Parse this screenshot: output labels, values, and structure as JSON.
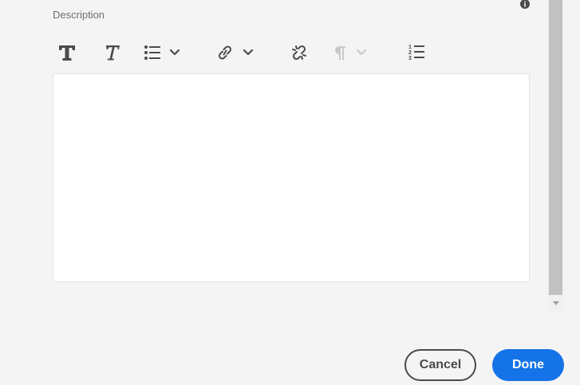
{
  "field": {
    "label": "Description"
  },
  "toolbar": {
    "icons": [
      "bold-text-icon",
      "italic-text-icon",
      "bullet-list-icon",
      "chevron-down-icon",
      "link-icon",
      "chevron-down-icon",
      "unlink-icon",
      "paragraph-icon",
      "chevron-down-icon",
      "numbered-list-icon"
    ],
    "paragraph_disabled": true
  },
  "editor": {
    "value": ""
  },
  "footer": {
    "cancel_label": "Cancel",
    "done_label": "Done"
  },
  "colors": {
    "background": "#f4f4f4",
    "icon": "#4b4b4b",
    "icon_disabled": "#c8c8c8",
    "primary": "#1473e6"
  }
}
